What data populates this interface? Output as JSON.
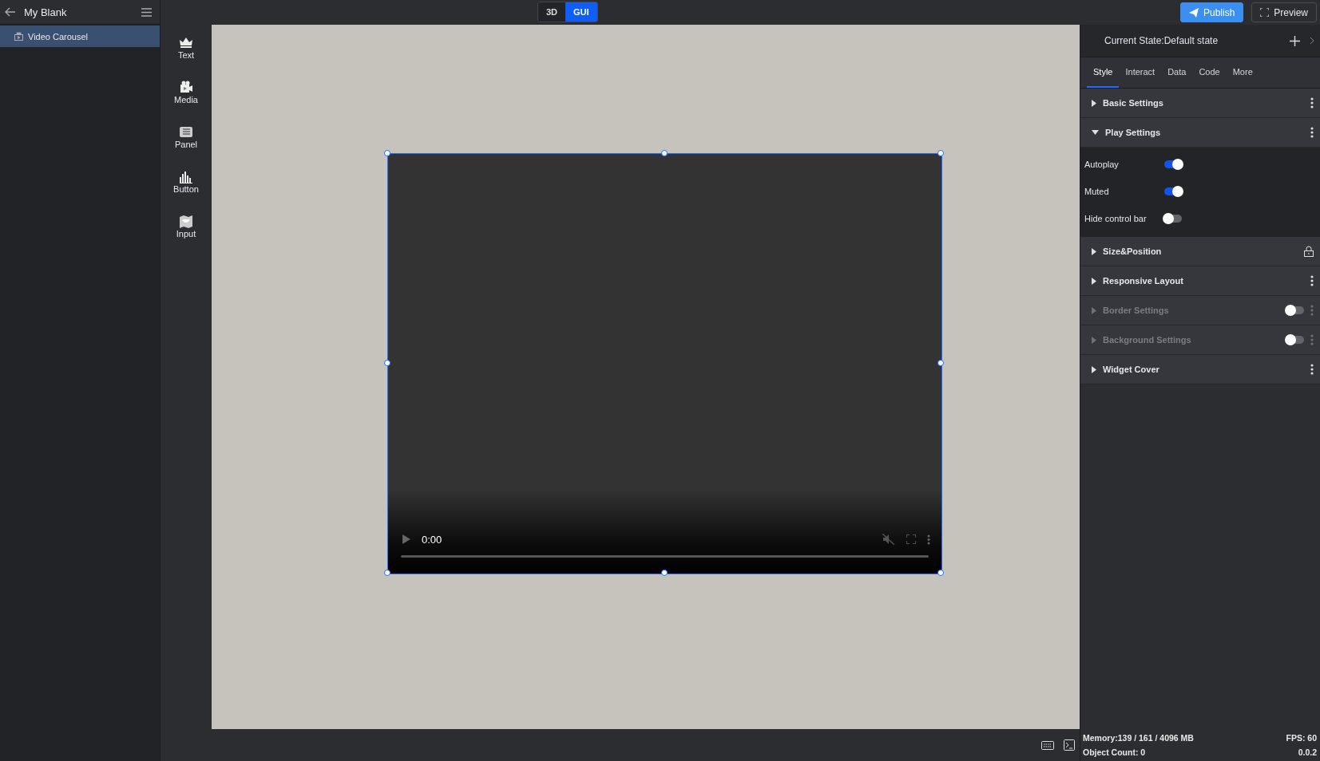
{
  "project": {
    "title": "My Blank"
  },
  "layers": [
    {
      "label": "Video Carousel",
      "selected": true
    }
  ],
  "tools": [
    {
      "kind": "text",
      "label": "Text"
    },
    {
      "kind": "media",
      "label": "Media"
    },
    {
      "kind": "panel",
      "label": "Panel"
    },
    {
      "kind": "button",
      "label": "Button"
    },
    {
      "kind": "input",
      "label": "Input"
    }
  ],
  "mode_switch": [
    {
      "label": "3D",
      "selected": false
    },
    {
      "label": "GUI",
      "selected": true
    }
  ],
  "actions": [
    {
      "kind": "publish",
      "label": "Publish"
    },
    {
      "kind": "preview",
      "label": "Preview"
    }
  ],
  "video": {
    "time": "0:00"
  },
  "inspector": {
    "state_label": "Current State:Default state",
    "tabs": [
      {
        "label": "Style",
        "selected": true
      },
      {
        "label": "Interact",
        "selected": false
      },
      {
        "label": "Data",
        "selected": false
      },
      {
        "label": "Code",
        "selected": false
      },
      {
        "label": "More",
        "selected": false
      }
    ],
    "sections": [
      {
        "title": "Basic Settings",
        "expanded": false,
        "disabled": false,
        "kind": "menu"
      },
      {
        "title": "Play Settings",
        "expanded": true,
        "disabled": false,
        "kind": "menu",
        "rows": [
          {
            "label": "Autoplay",
            "on": true
          },
          {
            "label": "Muted",
            "on": true
          },
          {
            "label": "Hide control bar",
            "on": false
          }
        ]
      },
      {
        "title": "Size&Position",
        "expanded": false,
        "disabled": false,
        "kind": "lock"
      },
      {
        "title": "Responsive Layout",
        "expanded": false,
        "disabled": false,
        "kind": "menu"
      },
      {
        "title": "Border Settings",
        "expanded": false,
        "disabled": true,
        "kind": "menu",
        "on": false
      },
      {
        "title": "Background Settings",
        "expanded": false,
        "disabled": true,
        "kind": "menu",
        "on": false
      },
      {
        "title": "Widget Cover",
        "expanded": false,
        "disabled": false,
        "kind": "menu"
      }
    ]
  },
  "status_bar": {
    "memory": "Memory:139 / 161 / 4096 MB",
    "fps": "FPS: 60",
    "objects": "Object Count: 0",
    "version": "0.0.2"
  }
}
